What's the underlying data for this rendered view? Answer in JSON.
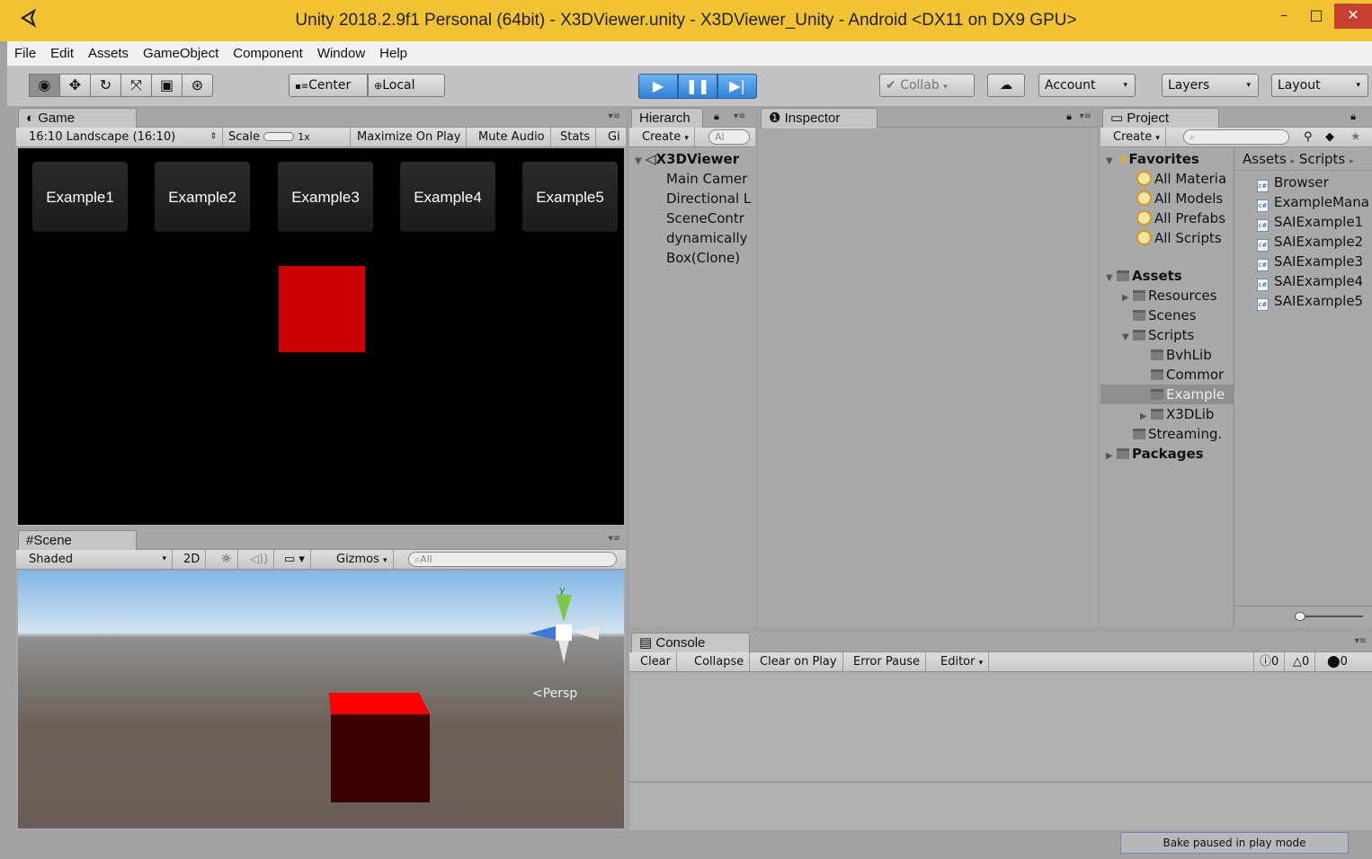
{
  "window": {
    "title": "Unity 2018.2.9f1 Personal (64bit) - X3DViewer.unity - X3DViewer_Unity - Android <DX11 on DX9 GPU>",
    "minimize": "–",
    "maximize": "□",
    "close": "✕"
  },
  "menu": [
    "File",
    "Edit",
    "Assets",
    "GameObject",
    "Component",
    "Window",
    "Help"
  ],
  "toolbar": {
    "center": "Center",
    "local": "Local",
    "collab": "Collab",
    "account": "Account",
    "layers": "Layers",
    "layout": "Layout"
  },
  "game": {
    "tab": "Game",
    "aspect": "16:10 Landscape (16:10)",
    "scale_label": "Scale",
    "scale_value": "1x",
    "maximize": "Maximize On Play",
    "mute": "Mute Audio",
    "stats": "Stats",
    "gizmos": "Gi",
    "buttons": [
      "Example1",
      "Example2",
      "Example3",
      "Example4",
      "Example5"
    ]
  },
  "scene": {
    "tab": "Scene",
    "shading": "Shaded",
    "mode2d": "2D",
    "gizmos": "Gizmos",
    "search": "All",
    "persp": "Persp",
    "axis_y": "y"
  },
  "hierarchy": {
    "tab": "Hierarch",
    "create": "Create",
    "search": "Al",
    "root": "X3DViewer",
    "items": [
      "Main Camer",
      "Directional L",
      "SceneContr",
      "dynamically",
      "Box(Clone)"
    ]
  },
  "inspector": {
    "tab": "Inspector"
  },
  "project": {
    "tab": "Project",
    "create": "Create",
    "favorites": "Favorites",
    "fav_items": [
      "All Materia",
      "All Models",
      "All Prefabs",
      "All Scripts"
    ],
    "assets": "Assets",
    "folders": [
      "Resources",
      "Scenes",
      "Scripts",
      "BvhLib",
      "Commor",
      "Example",
      "X3DLib",
      "Streaming.",
      "Packages"
    ],
    "breadcrumb": [
      "Assets",
      "Scripts"
    ],
    "files": [
      "Browser",
      "ExampleMana",
      "SAIExample1",
      "SAIExample2",
      "SAIExample3",
      "SAIExample4",
      "SAIExample5"
    ]
  },
  "console": {
    "tab": "Console",
    "clear": "Clear",
    "collapse": "Collapse",
    "clear_on_play": "Clear on Play",
    "error_pause": "Error Pause",
    "editor": "Editor",
    "info_count": "0",
    "warn_count": "0",
    "error_count": "0"
  },
  "status": {
    "text": "Bake paused in play mode"
  },
  "colors": {
    "title_bg": "#f1c232",
    "play_blue": "#2f80d8",
    "cube_red": "#cc0000",
    "selection": "#8f8f8f"
  }
}
